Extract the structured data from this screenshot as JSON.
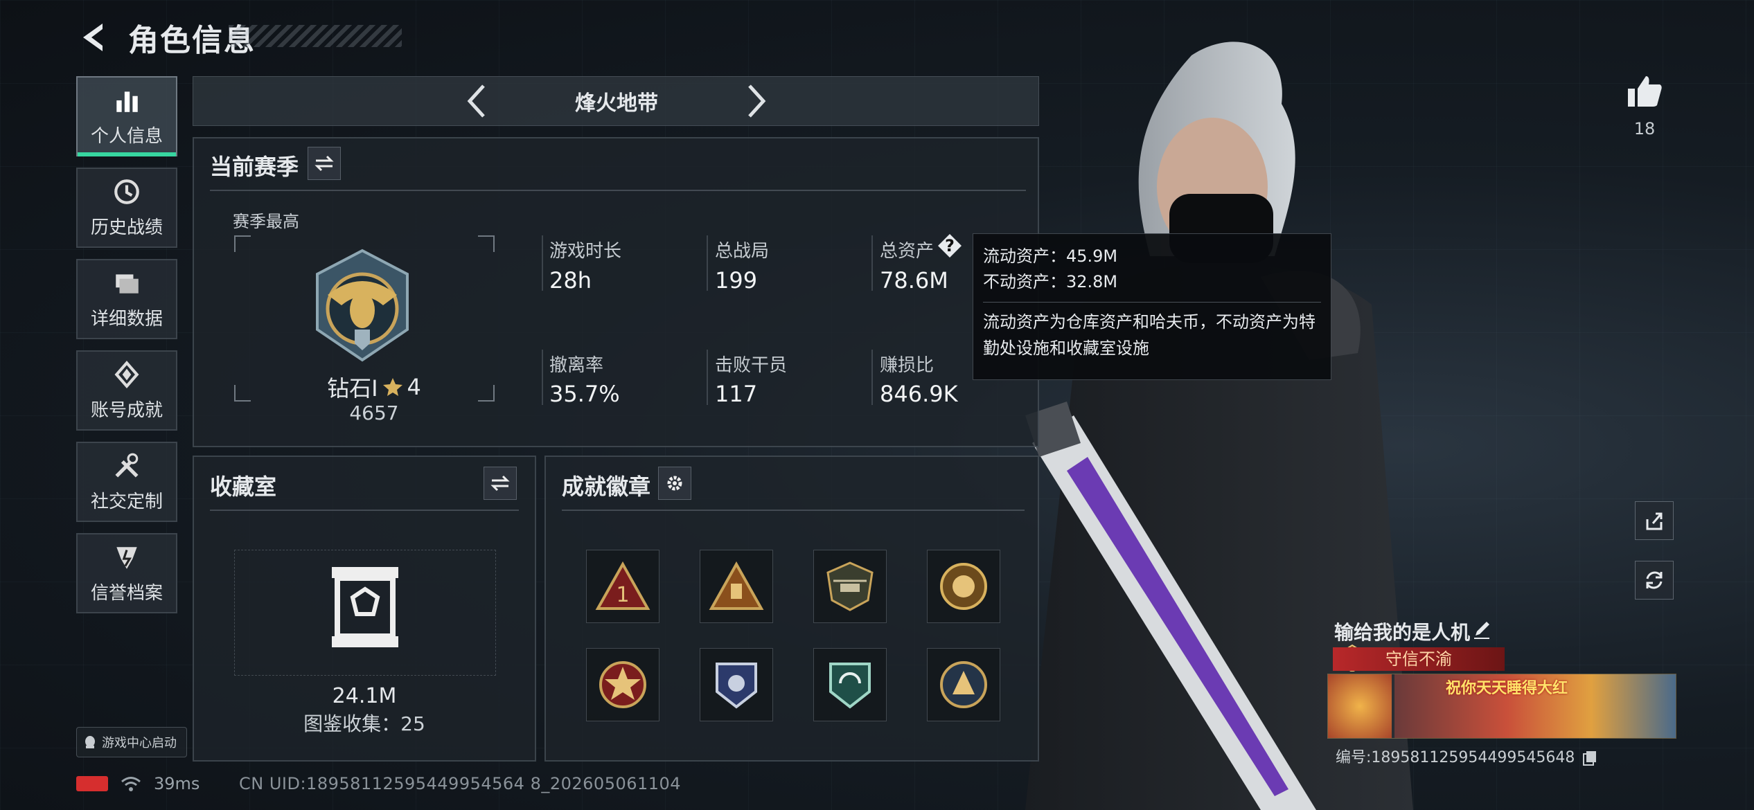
{
  "header": {
    "title": "角色信息"
  },
  "sidebar": {
    "items": [
      {
        "label": "个人信息",
        "icon": "bar-chart-icon",
        "active": true
      },
      {
        "label": "历史战绩",
        "icon": "history-icon"
      },
      {
        "label": "详细数据",
        "icon": "folder-icon"
      },
      {
        "label": "账号成就",
        "icon": "achievement-icon"
      },
      {
        "label": "社交定制",
        "icon": "tools-icon"
      },
      {
        "label": "信誉档案",
        "icon": "reputation-icon"
      }
    ],
    "launch_label": "游戏中心启动"
  },
  "mode": {
    "name": "烽火地带"
  },
  "season": {
    "title": "当前赛季",
    "best_label": "赛季最高",
    "rank_name": "钻石I",
    "rank_stars": "4",
    "rank_points": "4657",
    "stats": [
      {
        "label": "游戏时长",
        "value": "28h"
      },
      {
        "label": "总战局",
        "value": "199"
      },
      {
        "label": "总资产",
        "value": "78.6M",
        "help": "?"
      },
      {
        "label": "撤离率",
        "value": "35.7%"
      },
      {
        "label": "击败干员",
        "value": "117"
      },
      {
        "label": "赚损比",
        "value": "846.9K"
      }
    ]
  },
  "tooltip": {
    "line1": "流动资产：45.9M",
    "line2": "不动资产：32.8M",
    "desc": "流动资产为仓库资产和哈夫币，不动资产为特勤处设施和收藏室设施"
  },
  "collection": {
    "title": "收藏室",
    "value": "24.1M",
    "catalog": "图鉴收集：25"
  },
  "badges": {
    "title": "成就徽章",
    "items": [
      "rank-one-badge-icon",
      "pyramid-badge-icon",
      "helicopter-badge-icon",
      "mask-badge-icon",
      "star-badge-icon",
      "police-badge-icon",
      "arrows-shield-badge-icon",
      "beast-badge-icon"
    ]
  },
  "player": {
    "likes": "18",
    "name": "输给我的是人机",
    "title_tag": "守信不渝",
    "banner_text": "祝你天天睡得大红",
    "id_text": "编号:1895811259544995456​48"
  },
  "status": {
    "ping": "39ms",
    "uid": "CN UID:18958112595449954564 8_202605061104"
  },
  "colors": {
    "accent": "#37d6a0",
    "tag_red": "#b8282a",
    "battery": "#d62e2e"
  }
}
